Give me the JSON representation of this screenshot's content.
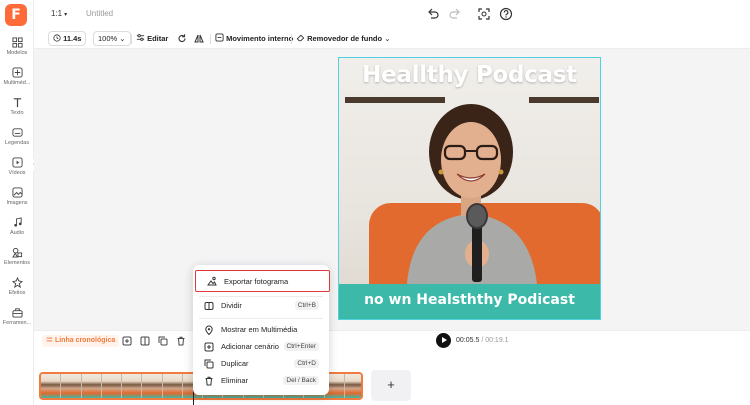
{
  "app": {
    "logo_letter": "F",
    "aspect_ratio": "1:1",
    "document_title": "Untitled",
    "accent_color": "#ff6a39"
  },
  "sidebar": {
    "items": [
      {
        "label": "Modelos",
        "icon": "templates-icon"
      },
      {
        "label": "Multiméd...",
        "icon": "media-upload-icon"
      },
      {
        "label": "Texto",
        "icon": "text-icon"
      },
      {
        "label": "Legendas",
        "icon": "subtitles-icon"
      },
      {
        "label": "Vídeos",
        "icon": "video-icon"
      },
      {
        "label": "Imagens",
        "icon": "image-icon"
      },
      {
        "label": "Áudio",
        "icon": "music-icon"
      },
      {
        "label": "Elementos",
        "icon": "elements-icon"
      },
      {
        "label": "Efeitos",
        "icon": "effects-icon"
      },
      {
        "label": "Ferramen...",
        "icon": "toolbox-icon"
      }
    ]
  },
  "toolbar": {
    "duration": "11.4s",
    "zoom": "100%",
    "edit_label": "Editar",
    "motion_label": "Movimento interno",
    "bg_remover_label": "Removedor de fundo"
  },
  "canvas": {
    "card_title": "Heallthy Podcast",
    "card_subtitle": "no wn Healsththy Podicast",
    "band_color": "#3cb9a9",
    "frame_color": "#52d2e0"
  },
  "context_menu": {
    "items": [
      {
        "label": "Exportar fotograma",
        "shortcut": "",
        "icon": "export-frame-icon",
        "highlighted": true
      },
      {
        "label": "Dividir",
        "shortcut": "Ctrl+B",
        "icon": "split-icon"
      },
      {
        "label": "Mostrar em Multimédia",
        "shortcut": "",
        "icon": "locate-icon"
      },
      {
        "label": "Adicionar cenário",
        "shortcut": "Ctrl+Enter",
        "icon": "add-scene-icon"
      },
      {
        "label": "Duplicar",
        "shortcut": "Ctrl+D",
        "icon": "duplicate-icon"
      },
      {
        "label": "Eliminar",
        "shortcut": "Del / Back",
        "icon": "trash-icon"
      }
    ]
  },
  "timeline": {
    "label": "Linha cronológica",
    "current_time": "00:05.5",
    "total_time": "/ 00:19.1",
    "add_label": "+",
    "frame_count": 16
  }
}
